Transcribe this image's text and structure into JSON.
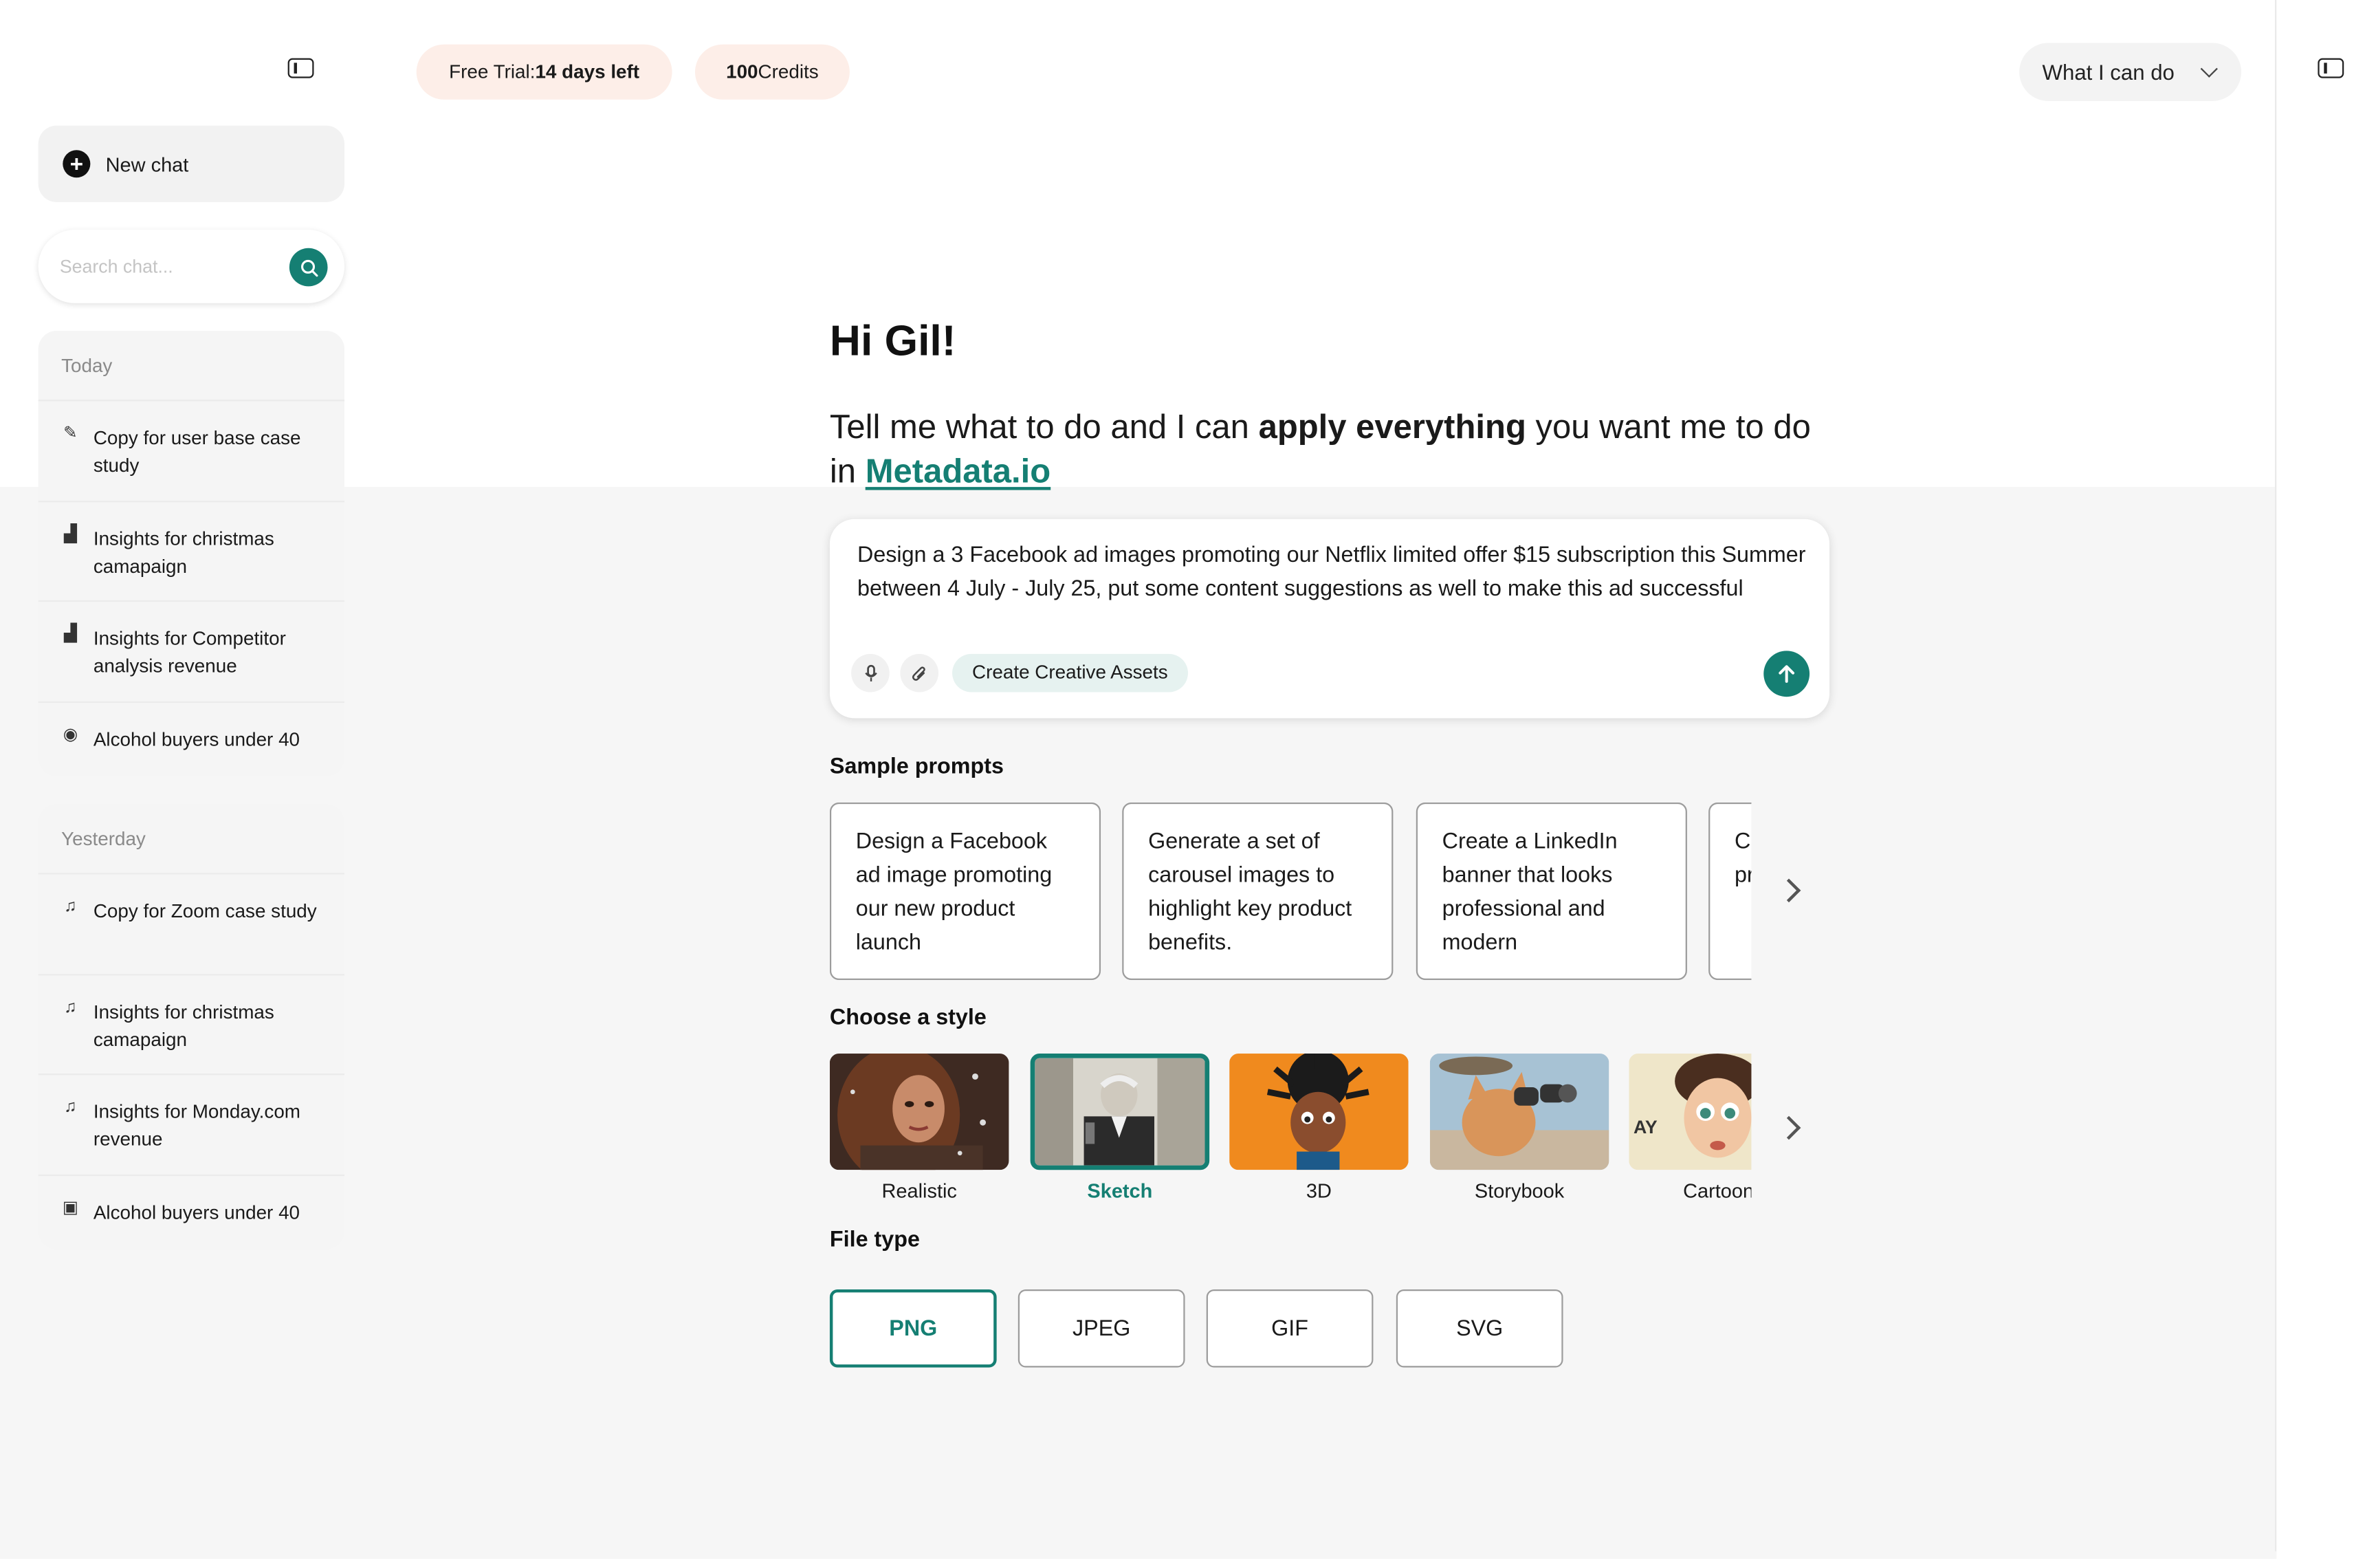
{
  "colors": {
    "accent": "#157f73",
    "trial_pill": "#fdeee8"
  },
  "sidebar": {
    "new_chat_label": "New chat",
    "search_placeholder": "Search chat...",
    "groups": [
      {
        "label": "Today",
        "items": [
          {
            "icon": "edit-icon",
            "label": "Copy for user base case study"
          },
          {
            "icon": "bar-chart-icon",
            "label": "Insights for christmas camapaign"
          },
          {
            "icon": "bar-chart-icon",
            "label": "Insights for Competitor analysis revenue"
          },
          {
            "icon": "user-circle-icon",
            "label": "Alcohol buyers under 40"
          }
        ]
      },
      {
        "label": "Yesterday",
        "items": [
          {
            "icon": "bell-icon",
            "label": "Copy for Zoom case study"
          },
          {
            "icon": "bell-icon",
            "label": "Insights for christmas camapaign"
          },
          {
            "icon": "bell-icon",
            "label": "Insights for Monday.com revenue"
          },
          {
            "icon": "image-icon",
            "label": "Alcohol buyers under 40"
          }
        ]
      }
    ]
  },
  "header": {
    "trial_prefix": "Free Trial: ",
    "trial_days": "14 days left",
    "credits_number": "100",
    "credits_label": " Credits",
    "what_i_can_do": "What I can do"
  },
  "main": {
    "greeting": "Hi Gil!",
    "intro_pre": "Tell me what to do and I can ",
    "intro_bold": "apply everything",
    "intro_mid": " you want me to do in ",
    "intro_link": "Metadata.io",
    "prompt_text": "Design a 3 Facebook ad images promoting our Netflix limited offer $15 subscription this Summer between 4 July - July 25, put some content suggestions as well to make this ad successful",
    "prompt_tag": "Create Creative Assets",
    "sample_prompts_title": "Sample prompts",
    "sample_prompts": [
      "Design a Facebook ad image promoting our new product launch",
      "Generate a set of carousel images to highlight key product benefits.",
      "Create a LinkedIn banner that looks professional and modern",
      "Create a banner promoting a modern"
    ],
    "style_title": "Choose a style",
    "styles": [
      {
        "label": "Realistic",
        "selected": false
      },
      {
        "label": "Sketch",
        "selected": true
      },
      {
        "label": "3D",
        "selected": false
      },
      {
        "label": "Storybook",
        "selected": false
      },
      {
        "label": "Cartoon",
        "selected": false
      }
    ],
    "file_type_title": "File type",
    "file_types": [
      {
        "label": "PNG",
        "selected": true
      },
      {
        "label": "JPEG",
        "selected": false
      },
      {
        "label": "GIF",
        "selected": false
      },
      {
        "label": "SVG",
        "selected": false
      }
    ]
  }
}
